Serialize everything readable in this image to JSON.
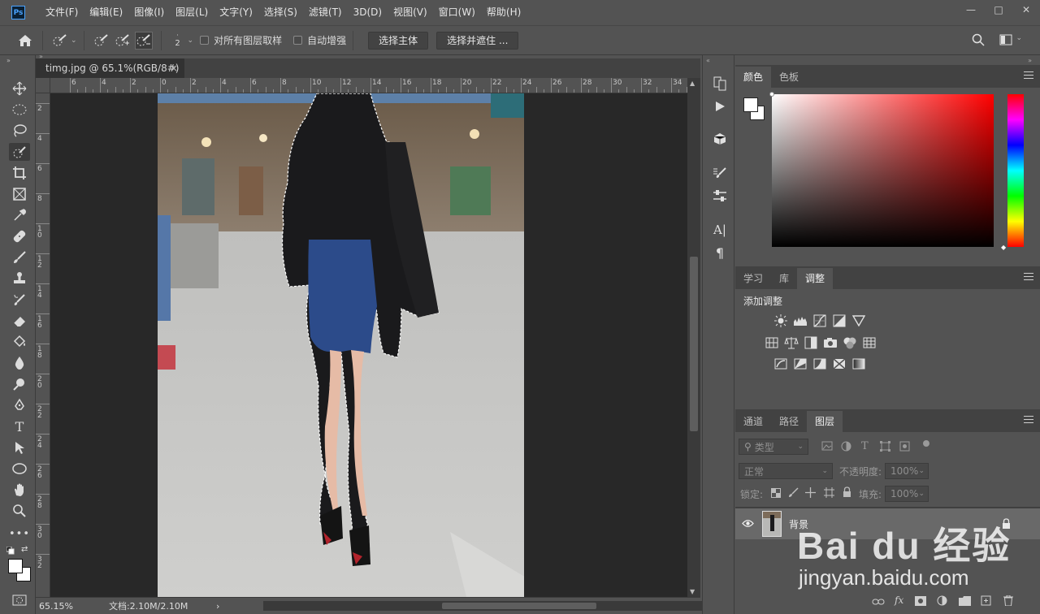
{
  "menubar": {
    "logo": "Ps",
    "items": [
      "文件(F)",
      "编辑(E)",
      "图像(I)",
      "图层(L)",
      "文字(Y)",
      "选择(S)",
      "滤镜(T)",
      "3D(D)",
      "视图(V)",
      "窗口(W)",
      "帮助(H)"
    ],
    "window_controls": [
      "—",
      "□",
      "✕"
    ]
  },
  "options": {
    "brush_size": "2",
    "sample_all_layers": "对所有图层取样",
    "auto_enhance": "自动增强",
    "select_subject": "选择主体",
    "select_and_mask": "选择并遮住 ..."
  },
  "document": {
    "tab_title": "timg.jpg @ 65.1%(RGB/8#)",
    "tab_close": "×",
    "ruler_top_labels": [
      "6",
      "4",
      "2",
      "0",
      "2",
      "4",
      "6",
      "8",
      "10",
      "12",
      "14",
      "16",
      "18",
      "20",
      "22",
      "24",
      "26",
      "28",
      "30",
      "32",
      "34"
    ],
    "ruler_left_labels": [
      "2",
      "4",
      "6",
      "8",
      "1 0",
      "1 2",
      "1 4",
      "1 6",
      "1 8",
      "2 0",
      "2 2",
      "2 4",
      "2 6",
      "2 8",
      "3 0",
      "3 2"
    ],
    "zoom": "65.15%",
    "doc_info": "文档:2.10M/2.10M",
    "status_arrow": "›"
  },
  "colors": {
    "foreground": "#ffffff",
    "background": "#ffffff",
    "hue_selected": "#ff0000"
  },
  "panel_color": {
    "tabs": [
      "颜色",
      "色板"
    ],
    "active": "颜色"
  },
  "panel_adjust": {
    "tabs": [
      "学习",
      "库",
      "调整"
    ],
    "active": "调整",
    "title": "添加调整"
  },
  "panel_layers": {
    "tabs": [
      "通道",
      "路径",
      "图层"
    ],
    "active": "图层",
    "filter_placeholder": "类型",
    "blend_mode": "正常",
    "opacity_label": "不透明度:",
    "opacity_value": "100%",
    "lock_label": "锁定:",
    "fill_label": "填充:",
    "fill_value": "100%",
    "layers": [
      {
        "name": "背景",
        "visible": true,
        "locked": true
      }
    ],
    "footer_icons": [
      "link-icon",
      "fx-icon",
      "mask-icon",
      "adjustment-icon",
      "group-icon",
      "new-layer-icon",
      "trash-icon"
    ]
  },
  "watermark": {
    "brand": "Bai du 经验",
    "url": "jingyan.baidu.com"
  }
}
